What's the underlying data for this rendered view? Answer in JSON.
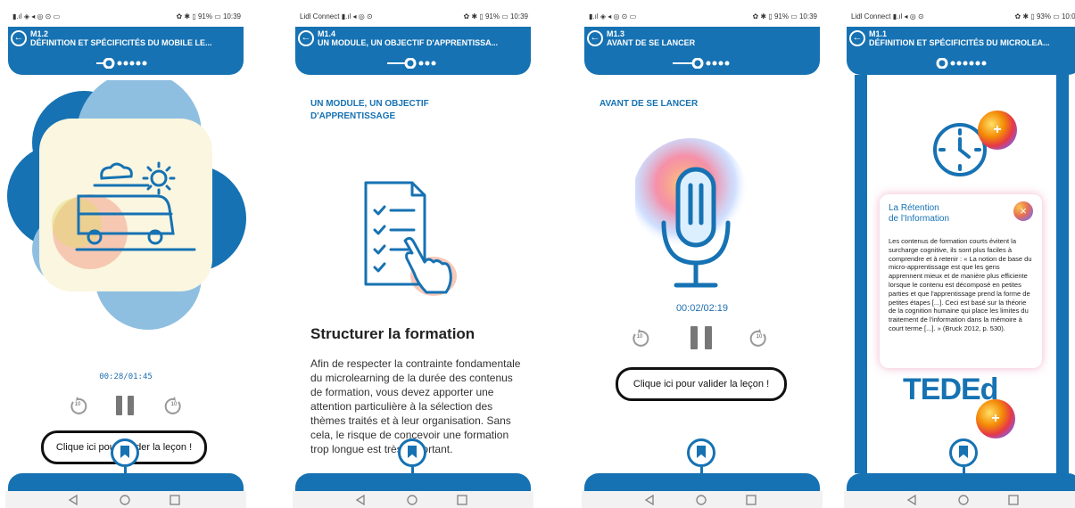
{
  "status": {
    "left_icons": "▮.ıl ◈ ◂ ◎ ⊙ ▭",
    "right_icons_a": "✿ ✱ ▯ 91% ▭ 10:39",
    "carrier": "Lidl Connect ▮.ıl ◂ ◎ ⊙",
    "right_icons_d": "✿ ✱ ▯ 93% ▭ 10:02"
  },
  "screens": [
    {
      "code": "M1.2",
      "title": "DÉFINITION ET SPÉCIFICITÉS DU MOBILE LE...",
      "progress": {
        "active": 1,
        "total": 6
      },
      "timecode": "00:28/01:45",
      "skip_label": "10",
      "validate_label": "Clique ici pour valider la leçon !"
    },
    {
      "code": "M1.4",
      "title": "UN MODULE, UN OBJECTIF D'APPRENTISSA...",
      "progress": {
        "active": 2,
        "total": 4
      },
      "section_title": "UN MODULE, UN OBJECTIF\nD'APPRENTISSAGE",
      "heading": "Structurer la formation",
      "body": "Afin de respecter la contrainte fondamentale du microlearning de la durée des contenus de formation, vous devez apporter une attention particulière à la sélection des thèmes traités et à leur organisation. Sans cela, le risque de concevoir une formation trop longue est très important."
    },
    {
      "code": "M1.3",
      "title": "AVANT DE SE LANCER",
      "progress": {
        "active": 2,
        "total": 5
      },
      "section_title": "AVANT DE SE LANCER",
      "timecode": "00:02/02:19",
      "skip_label": "10",
      "validate_label": "Clique ici pour valider la leçon !"
    },
    {
      "code": "M1.1",
      "title": "DÉFINITION ET SPÉCIFICITÉS DU MICROLEA...",
      "progress": {
        "active": 1,
        "total": 7
      },
      "card_title": "La Rétention\nde l'Information",
      "card_body": "Les contenus de formation courts évitent la surcharge cognitive, ils sont plus faciles à comprendre et à retenir : « La notion de base du micro-apprentissage est que les gens apprennent mieux et de manière plus efficiente lorsque le contenu est décomposé en petites parties et que l'apprentissage prend la forme de petites étapes [...]. Ceci est basé sur la théorie de la cognition humaine qui place les limites du traitement de l'information dans la mémoire à court terme [...]. » (Bruck 2012, p. 530).",
      "close_symbol": "×",
      "plus_symbol": "+",
      "brand": "TEDEd"
    }
  ],
  "colors": {
    "primary": "#1672b3",
    "light_blue": "#8fbfe0",
    "cream": "#fbf6e0"
  },
  "icons": [
    "back-arrow-icon",
    "bus-icon",
    "checklist-icon",
    "microphone-icon",
    "clock-icon",
    "bookmark-icon",
    "replay-10-icon",
    "forward-10-icon",
    "pause-icon"
  ]
}
